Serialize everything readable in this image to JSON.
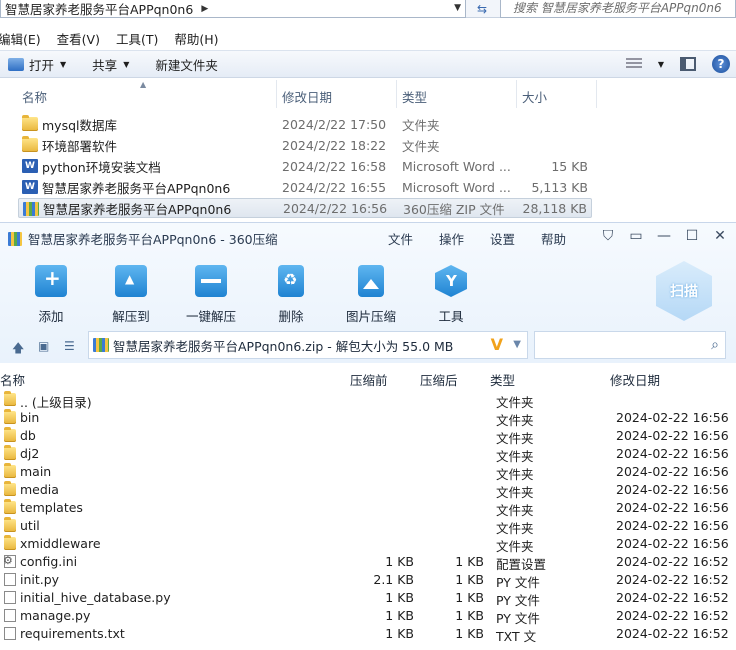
{
  "explorer": {
    "breadcrumb": "智慧居家养老服务平台APPqn0n6",
    "search_placeholder": "搜索 智慧居家养老服务平台APPqn0n6",
    "menu": [
      "编辑(E)",
      "查看(V)",
      "工具(T)",
      "帮助(H)"
    ],
    "toolbar": {
      "open": "打开",
      "share": "共享",
      "new_folder": "新建文件夹"
    },
    "columns": {
      "name": "名称",
      "date": "修改日期",
      "type": "类型",
      "size": "大小"
    },
    "rows": [
      {
        "name": "mysql数据库",
        "date": "2024/2/22 17:50",
        "type": "文件夹",
        "size": "",
        "icon": "folder-icon"
      },
      {
        "name": "环境部署软件",
        "date": "2024/2/22 18:22",
        "type": "文件夹",
        "size": "",
        "icon": "folder-icon"
      },
      {
        "name": "python环境安装文档",
        "date": "2024/2/22 16:58",
        "type": "Microsoft Word ...",
        "size": "15 KB",
        "icon": "word-icon"
      },
      {
        "name": "智慧居家养老服务平台APPqn0n6",
        "date": "2024/2/22 16:55",
        "type": "Microsoft Word ...",
        "size": "5,113 KB",
        "icon": "word-icon"
      },
      {
        "name": "智慧居家养老服务平台APPqn0n6",
        "date": "2024/2/22 16:56",
        "type": "360压缩 ZIP 文件",
        "size": "28,118 KB",
        "icon": "zip-icon"
      }
    ]
  },
  "zip": {
    "title": "智慧居家养老服务平台APPqn0n6 - 360压缩",
    "menu": [
      "文件",
      "操作",
      "设置",
      "帮助"
    ],
    "tools": [
      "添加",
      "解压到",
      "一键解压",
      "删除",
      "图片压缩",
      "工具"
    ],
    "scan_label": "扫描",
    "path": "智慧居家养老服务平台APPqn0n6.zip - 解包大小为 55.0 MB",
    "columns": {
      "name": "名称",
      "before": "压缩前",
      "after": "压缩后",
      "type": "类型",
      "date": "修改日期"
    },
    "rows": [
      {
        "name": ".. (上级目录)",
        "before": "",
        "after": "",
        "type": "文件夹",
        "date": "",
        "icon": "folder-icon"
      },
      {
        "name": "bin",
        "before": "",
        "after": "",
        "type": "文件夹",
        "date": "2024-02-22 16:56",
        "icon": "folder-icon"
      },
      {
        "name": "db",
        "before": "",
        "after": "",
        "type": "文件夹",
        "date": "2024-02-22 16:56",
        "icon": "folder-icon"
      },
      {
        "name": "dj2",
        "before": "",
        "after": "",
        "type": "文件夹",
        "date": "2024-02-22 16:56",
        "icon": "folder-icon"
      },
      {
        "name": "main",
        "before": "",
        "after": "",
        "type": "文件夹",
        "date": "2024-02-22 16:56",
        "icon": "folder-icon"
      },
      {
        "name": "media",
        "before": "",
        "after": "",
        "type": "文件夹",
        "date": "2024-02-22 16:56",
        "icon": "folder-icon"
      },
      {
        "name": "templates",
        "before": "",
        "after": "",
        "type": "文件夹",
        "date": "2024-02-22 16:56",
        "icon": "folder-icon"
      },
      {
        "name": "util",
        "before": "",
        "after": "",
        "type": "文件夹",
        "date": "2024-02-22 16:56",
        "icon": "folder-icon"
      },
      {
        "name": "xmiddleware",
        "before": "",
        "after": "",
        "type": "文件夹",
        "date": "2024-02-22 16:56",
        "icon": "folder-icon"
      },
      {
        "name": "config.ini",
        "before": "1 KB",
        "after": "1 KB",
        "type": "配置设置",
        "date": "2024-02-22 16:52",
        "icon": "settings-file-icon"
      },
      {
        "name": "init.py",
        "before": "2.1 KB",
        "after": "1 KB",
        "type": "PY 文件",
        "date": "2024-02-22 16:52",
        "icon": "file-icon"
      },
      {
        "name": "initial_hive_database.py",
        "before": "1 KB",
        "after": "1 KB",
        "type": "PY 文件",
        "date": "2024-02-22 16:52",
        "icon": "file-icon"
      },
      {
        "name": "manage.py",
        "before": "1 KB",
        "after": "1 KB",
        "type": "PY 文件",
        "date": "2024-02-22 16:52",
        "icon": "file-icon"
      },
      {
        "name": "requirements.txt",
        "before": "1 KB",
        "after": "1 KB",
        "type": "TXT 文",
        "date": "2024-02-22 16:52",
        "icon": "file-icon"
      }
    ]
  }
}
